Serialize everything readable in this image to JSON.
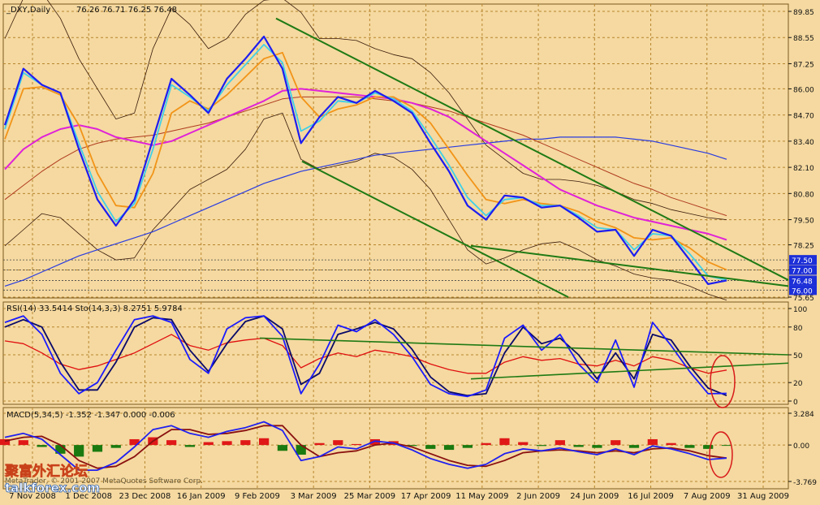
{
  "chart_data": [
    {
      "type": "line",
      "panel": "price",
      "title": "_DXY,Daily",
      "ohlc_label": "76.26 76.71 76.25 76.48",
      "ylim": [
        75.65,
        89.85
      ],
      "y_ticks": [
        "89.85",
        "88.55",
        "87.25",
        "86.00",
        "84.70",
        "83.40",
        "82.10",
        "80.80",
        "79.50",
        "78.25",
        "77.00",
        "75.65"
      ],
      "y_tick_values": [
        89.85,
        88.55,
        87.25,
        86.0,
        84.7,
        83.4,
        82.1,
        80.8,
        79.5,
        78.25,
        77.0,
        75.65
      ],
      "price_levels": [
        {
          "label": "77.50",
          "value": 77.5
        },
        {
          "label": "77.00",
          "value": 77.0
        },
        {
          "label": "76.48",
          "value": 76.48
        },
        {
          "label": "76.00",
          "value": 76.0
        }
      ],
      "x_labels": [
        "7 Nov 2008",
        "1 Dec 2008",
        "23 Dec 2008",
        "16 Jan 2009",
        "9 Feb 2009",
        "3 Mar 2009",
        "25 Mar 2009",
        "17 Apr 2009",
        "11 May 2009",
        "2 Jun 2009",
        "24 Jun 2009",
        "16 Jul 2009",
        "7 Aug 2009",
        "31 Aug 2009"
      ],
      "series": [
        {
          "values": [
            84.2,
            87.0,
            86.2,
            85.8,
            83.0,
            80.5,
            79.2,
            80.5,
            83.5,
            86.5,
            85.7,
            84.8,
            86.5,
            87.5,
            88.6,
            87.0,
            83.3,
            84.6,
            85.6,
            85.3,
            85.9,
            85.4,
            84.8,
            83.3,
            81.9,
            80.2,
            79.5,
            80.7,
            80.6,
            80.1,
            80.2,
            79.6,
            78.9,
            79.0,
            77.7,
            79.0,
            78.7,
            77.5,
            76.3,
            76.48
          ]
        },
        {
          "values": [
            84.0,
            86.8,
            86.2,
            85.8,
            83.3,
            80.9,
            79.4,
            80.3,
            83.0,
            86.2,
            85.6,
            84.9,
            86.2,
            87.2,
            88.2,
            87.3,
            83.9,
            84.4,
            85.4,
            85.3,
            85.8,
            85.5,
            84.9,
            83.6,
            82.2,
            80.6,
            79.7,
            80.5,
            80.6,
            80.2,
            80.2,
            79.7,
            79.1,
            79.0,
            78.0,
            78.8,
            78.7,
            77.8,
            76.7,
            76.5
          ]
        },
        {
          "values": [
            83.5,
            86.0,
            86.1,
            85.7,
            84.2,
            81.8,
            80.2,
            80.1,
            81.8,
            84.8,
            85.4,
            85.0,
            85.7,
            86.6,
            87.5,
            87.8,
            85.6,
            84.6,
            85.0,
            85.2,
            85.6,
            85.6,
            85.1,
            84.3,
            83.0,
            81.7,
            80.5,
            80.3,
            80.5,
            80.3,
            80.2,
            79.9,
            79.4,
            79.1,
            78.6,
            78.5,
            78.6,
            78.1,
            77.4,
            77.0
          ]
        },
        {
          "values": [
            82.0,
            83.0,
            83.6,
            84.0,
            84.2,
            84.0,
            83.6,
            83.4,
            83.2,
            83.4,
            83.8,
            84.2,
            84.6,
            85.0,
            85.4,
            85.9,
            86.0,
            85.9,
            85.8,
            85.7,
            85.6,
            85.5,
            85.3,
            85.0,
            84.6,
            84.0,
            83.4,
            82.8,
            82.2,
            81.6,
            81.0,
            80.6,
            80.2,
            79.9,
            79.6,
            79.4,
            79.2,
            79.0,
            78.8,
            78.5
          ]
        },
        {
          "values": [
            80.5,
            81.2,
            81.9,
            82.5,
            83.0,
            83.3,
            83.5,
            83.6,
            83.7,
            83.9,
            84.1,
            84.3,
            84.6,
            84.9,
            85.2,
            85.5,
            85.6,
            85.6,
            85.6,
            85.6,
            85.5,
            85.4,
            85.3,
            85.1,
            84.9,
            84.6,
            84.3,
            84.0,
            83.7,
            83.3,
            82.9,
            82.5,
            82.1,
            81.7,
            81.3,
            81.0,
            80.6,
            80.3,
            80.0,
            79.7
          ]
        },
        {
          "values": [
            76.2,
            76.5,
            76.9,
            77.3,
            77.7,
            78.0,
            78.3,
            78.6,
            78.9,
            79.3,
            79.7,
            80.1,
            80.5,
            80.9,
            81.3,
            81.6,
            81.9,
            82.1,
            82.3,
            82.5,
            82.7,
            82.8,
            82.9,
            83.0,
            83.1,
            83.2,
            83.3,
            83.4,
            83.5,
            83.5,
            83.6,
            83.6,
            83.6,
            83.6,
            83.5,
            83.4,
            83.2,
            83.0,
            82.8,
            82.5
          ]
        },
        {
          "values": [
            88.5,
            90.5,
            90.8,
            89.5,
            87.5,
            86.0,
            84.5,
            84.8,
            88.0,
            90.0,
            89.2,
            88.0,
            88.5,
            89.7,
            90.4,
            90.5,
            89.8,
            88.5,
            88.5,
            88.4,
            88.0,
            87.7,
            87.5,
            86.8,
            85.8,
            84.5,
            83.2,
            82.5,
            81.8,
            81.5,
            81.5,
            81.4,
            81.2,
            80.9,
            80.5,
            80.3,
            80.0,
            79.8,
            79.6,
            79.5
          ]
        },
        {
          "values": [
            78.2,
            79.0,
            79.8,
            79.6,
            78.8,
            78.0,
            77.5,
            77.6,
            79.0,
            80.0,
            81.0,
            81.5,
            82.0,
            83.0,
            84.5,
            84.8,
            82.5,
            82.0,
            82.2,
            82.4,
            82.8,
            82.6,
            82.0,
            81.0,
            79.5,
            78.0,
            77.3,
            77.6,
            78.0,
            78.3,
            78.4,
            78.0,
            77.5,
            77.2,
            76.8,
            76.6,
            76.5,
            76.2,
            75.8,
            75.5
          ]
        }
      ]
    },
    {
      "type": "line",
      "panel": "oscillator",
      "title": "RSI(14) 33.5414  Sto(14,3,3) 8.2751  5.9784",
      "ylim": [
        0,
        100
      ],
      "y_ticks": [
        "100",
        "80",
        "50",
        "20",
        "0"
      ],
      "y_tick_values": [
        100,
        80,
        50,
        20,
        0
      ],
      "series": [
        {
          "values": [
            65,
            62,
            52,
            40,
            34,
            38,
            45,
            52,
            62,
            72,
            60,
            55,
            63,
            66,
            68,
            60,
            36,
            46,
            52,
            48,
            55,
            52,
            48,
            40,
            34,
            30,
            30,
            42,
            48,
            44,
            46,
            40,
            38,
            44,
            38,
            48,
            44,
            36,
            30,
            33.5
          ]
        },
        {
          "values": [
            85,
            92,
            72,
            30,
            8,
            20,
            55,
            88,
            92,
            85,
            45,
            30,
            78,
            90,
            92,
            70,
            8,
            40,
            82,
            75,
            88,
            72,
            48,
            18,
            8,
            5,
            12,
            68,
            82,
            55,
            72,
            40,
            20,
            66,
            15,
            85,
            60,
            32,
            8,
            8.3
          ]
        },
        {
          "values": [
            80,
            88,
            80,
            42,
            12,
            12,
            42,
            80,
            90,
            88,
            55,
            32,
            62,
            86,
            92,
            78,
            18,
            30,
            72,
            78,
            85,
            78,
            56,
            26,
            10,
            6,
            8,
            52,
            80,
            62,
            68,
            50,
            24,
            52,
            24,
            72,
            66,
            38,
            14,
            6.0
          ]
        }
      ]
    },
    {
      "type": "bar",
      "panel": "macd",
      "title": "MACD(5,34,5) -1.352 -1.347 0.000 -0.006",
      "ylim": [
        -3.769,
        3.284
      ],
      "y_ticks": [
        "3.284",
        "0.00",
        "-3.769"
      ],
      "y_tick_values": [
        3.284,
        0.0,
        -3.769
      ],
      "histogram": [
        0.6,
        0.5,
        -0.2,
        -0.9,
        -1.2,
        -0.7,
        -0.3,
        0.6,
        0.8,
        0.5,
        -0.2,
        0.3,
        0.4,
        0.5,
        0.7,
        -0.6,
        -1.0,
        0.2,
        0.5,
        0.1,
        0.6,
        0.4,
        -0.1,
        -0.4,
        -0.5,
        -0.3,
        0.2,
        0.7,
        0.3,
        -0.1,
        0.5,
        -0.2,
        -0.3,
        0.5,
        -0.3,
        0.6,
        0.2,
        -0.3,
        -0.4,
        -0.006
      ],
      "series": [
        {
          "values": [
            0.8,
            1.2,
            0.6,
            -1.0,
            -2.6,
            -2.6,
            -1.8,
            -0.2,
            1.6,
            2.0,
            1.2,
            0.8,
            1.4,
            1.8,
            2.4,
            1.5,
            -1.6,
            -1.2,
            -0.2,
            -0.4,
            0.4,
            0.2,
            -0.5,
            -1.4,
            -2.0,
            -2.4,
            -2.0,
            -0.9,
            -0.4,
            -0.6,
            -0.3,
            -0.7,
            -1.0,
            -0.4,
            -1.0,
            -0.1,
            -0.4,
            -0.9,
            -1.5,
            -1.352
          ]
        },
        {
          "values": [
            0.4,
            0.8,
            0.9,
            0.0,
            -1.6,
            -2.4,
            -2.2,
            -1.2,
            0.4,
            1.6,
            1.6,
            1.1,
            1.2,
            1.5,
            2.0,
            2.0,
            0.0,
            -1.2,
            -0.8,
            -0.6,
            0.0,
            0.2,
            -0.2,
            -0.9,
            -1.6,
            -2.1,
            -2.2,
            -1.6,
            -0.8,
            -0.6,
            -0.5,
            -0.6,
            -0.8,
            -0.6,
            -0.8,
            -0.4,
            -0.3,
            -0.6,
            -1.1,
            -1.347
          ]
        }
      ]
    }
  ],
  "watermark": {
    "cn_text": "聚富外汇论坛",
    "brand": "talkforex.com",
    "copyright": "MetaTrader, © 2001-2007 MetaQuotes Software Corp."
  },
  "colors": {
    "background": "#f5d9a0",
    "grid": "#b8862f",
    "price_line": "#1a1a8c",
    "close_line": "#1d1df0",
    "ema_fast": "#40d0e8",
    "ema_mid": "#f29418",
    "ma_magenta": "#e022d8",
    "ma_darkred": "#b03a1e",
    "ma_blue": "#2a3ce0",
    "bands": "#3a1a0a",
    "channel": "#1f7a14",
    "rsi": "#e01010",
    "sto_main": "#1a1aff",
    "sto_signal": "#0a0a6a",
    "macd_pos": "#e01818",
    "macd_neg": "#1a7a10",
    "macd_line": "#2020f0",
    "macd_signal": "#8a1010",
    "circle": "#d81a1a"
  }
}
